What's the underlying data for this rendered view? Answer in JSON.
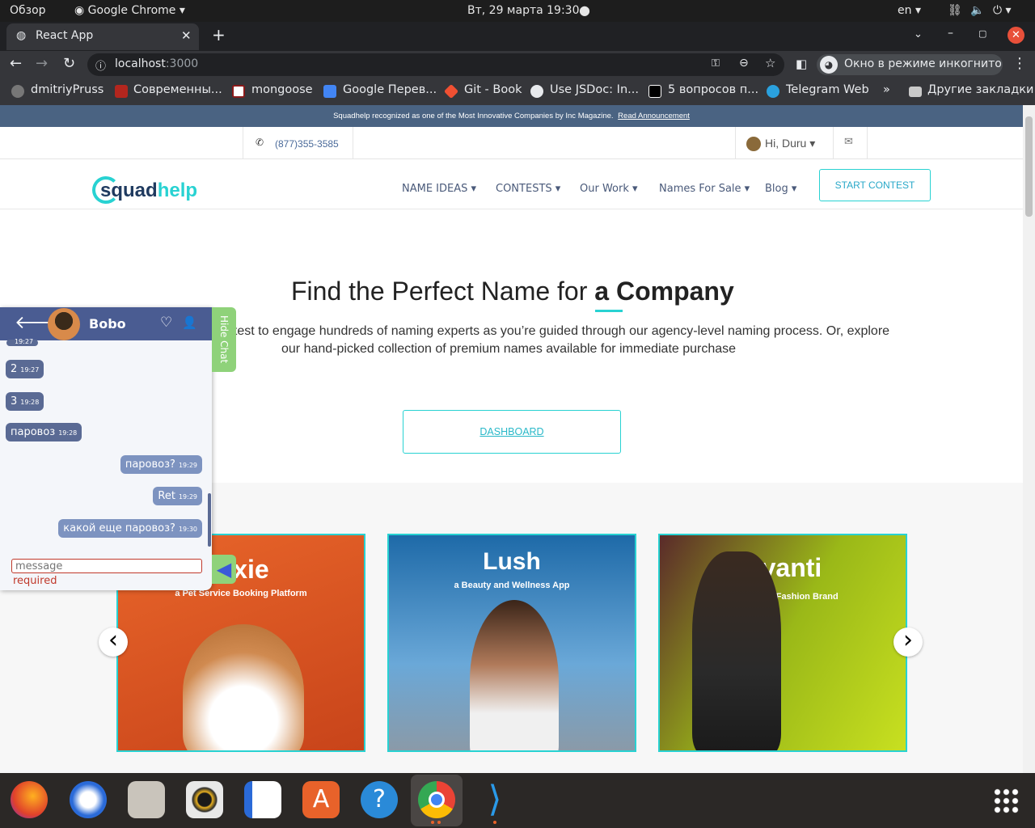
{
  "system": {
    "activities": "Обзор",
    "app_menu": "Google Chrome",
    "clock": "Вт, 29 марта  19:30",
    "lang": "en"
  },
  "browser": {
    "tab_title": "React App",
    "url_host": "localhost",
    "url_port": ":3000",
    "incognito_label": "Окно в режиме инкогнито",
    "bookmarks": [
      "dmitriyPruss",
      "Современны...",
      "mongoose",
      "Google Перев...",
      "Git - Book",
      "Use JSDoc: In...",
      "5 вопросов п...",
      "Telegram Web"
    ],
    "more": "»",
    "other_bookmarks": "Другие закладки"
  },
  "site": {
    "banner_text": "Squadhelp recognized as one of the Most Innovative Companies by Inc Magazine.",
    "banner_link": "Read Announcement",
    "phone": "(877)355-3585",
    "greeting": "Hi, Duru",
    "logo_a": "squad",
    "logo_b": "help",
    "nav": [
      "NAME IDEAS",
      "CONTESTS",
      "Our Work",
      "Names For Sale",
      "Blog"
    ],
    "start_contest": "START CONTEST",
    "hero_title_a": "Find the Perfect Name for",
    "hero_title_b": "a Company",
    "hero_sub_1": "ntest to engage hundreds of naming experts as you’re guided through our agency-level naming process. Or, explore",
    "hero_sub_2": "our hand-picked collection of premium names available for immediate purchase",
    "dashboard_button": "DASHBOARD",
    "cards": [
      {
        "title": "wxie",
        "subtitle": "a Pet Service Booking Platform"
      },
      {
        "title": "Lush",
        "subtitle": "a Beauty and Wellness App"
      },
      {
        "title": "Avanti",
        "subtitle": "a High End Fashion Brand"
      }
    ]
  },
  "chat": {
    "contact": "Bobo",
    "hide_label": "Hide Chat",
    "partial_time": "19:27",
    "messages": [
      {
        "text": "2",
        "time": "19:27",
        "dir": "in"
      },
      {
        "text": "3",
        "time": "19:28",
        "dir": "in"
      },
      {
        "text": "паровоз",
        "time": "19:28",
        "dir": "in"
      },
      {
        "text": "паровоз?",
        "time": "19:29",
        "dir": "out"
      },
      {
        "text": "Ret",
        "time": "19:29",
        "dir": "out"
      },
      {
        "text": "какой еще паровоз?",
        "time": "19:30",
        "dir": "out"
      }
    ],
    "input_placeholder": "message",
    "error": "required"
  },
  "colors": {
    "accent": "#28d2d2",
    "chat_header": "#4a5c92",
    "banner": "#4a6382"
  }
}
